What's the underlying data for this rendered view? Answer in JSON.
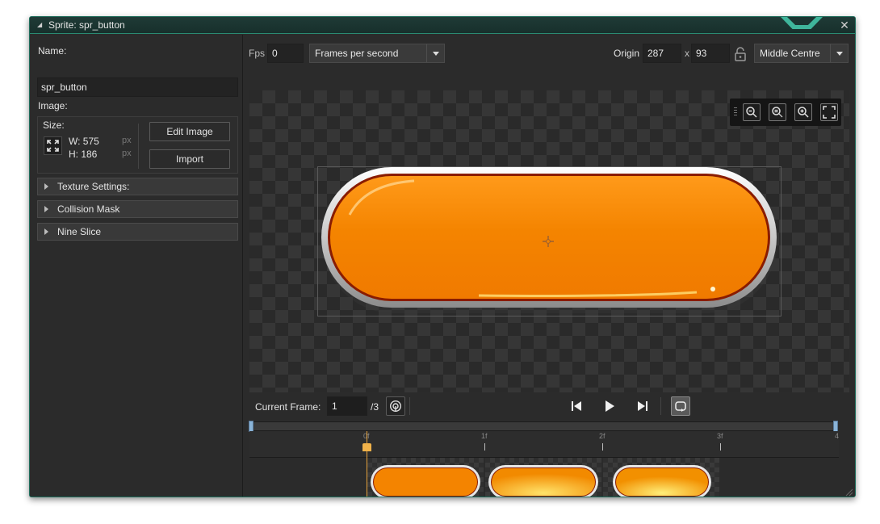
{
  "window": {
    "title": "Sprite: spr_button",
    "close_glyph": "✕"
  },
  "left_panel": {
    "name_label": "Name:",
    "name_value": "spr_button",
    "image_label": "Image:",
    "size_label": "Size:",
    "width_label": "W: 575",
    "height_label": "H: 186",
    "unit": "px",
    "edit_image_label": "Edit Image",
    "import_label": "Import",
    "sections": [
      {
        "label": "Texture Settings:"
      },
      {
        "label": "Collision Mask"
      },
      {
        "label": "Nine Slice"
      }
    ]
  },
  "toolbar": {
    "fps_label": "Fps",
    "fps_value": "0",
    "fps_mode": "Frames per second",
    "origin_label": "Origin",
    "origin_x": "287",
    "origin_sep": "x",
    "origin_y": "93",
    "origin_preset": "Middle Centre"
  },
  "zoom_tools": [
    {
      "icon": "zoom-out-icon"
    },
    {
      "icon": "zoom-reset-icon"
    },
    {
      "icon": "zoom-in-icon"
    },
    {
      "icon": "fullscreen-icon"
    }
  ],
  "playback": {
    "current_frame_label": "Current Frame:",
    "current_frame_value": "1",
    "total_frames": "/3"
  },
  "timeline": {
    "ticks": [
      "0f",
      "1f",
      "2f",
      "3f",
      "4"
    ],
    "playhead_frame": 0
  },
  "colors": {
    "accent": "#2a8a72",
    "button_orange": "#f58200",
    "button_rim": "#8a1c00",
    "playhead": "#f0b24a"
  }
}
